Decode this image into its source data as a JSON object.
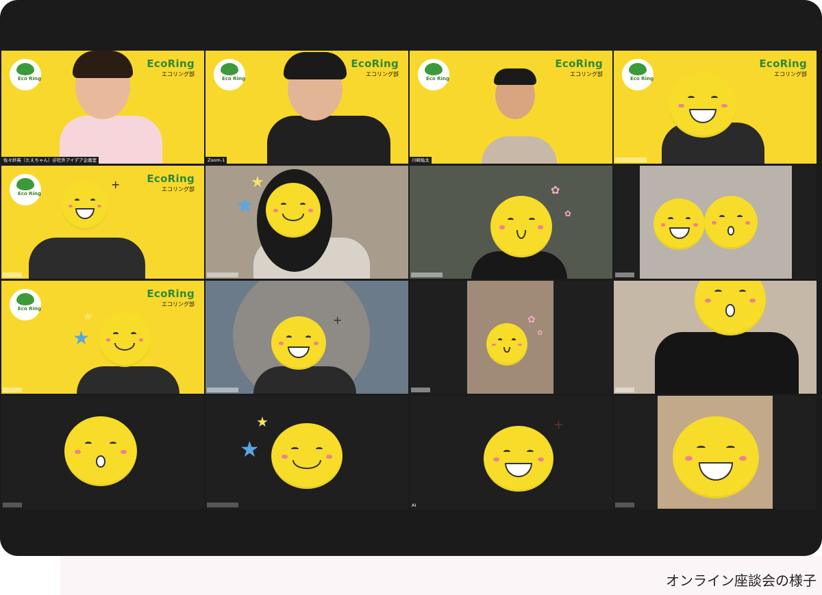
{
  "caption": "オンライン座談会の様子",
  "brand": {
    "title": "EcoRing",
    "subtitle": "エコリング部",
    "logo_text": "Eco Ring"
  },
  "participants": [
    {
      "name": "佐々紗英（たえちゃん）＠社外アイデア企画室"
    },
    {
      "name": "Zoom-1"
    },
    {
      "name": "川崎佑太"
    },
    {
      "name": ""
    },
    {
      "name": ""
    },
    {
      "name": ""
    },
    {
      "name": ""
    },
    {
      "name": ""
    },
    {
      "name": ""
    },
    {
      "name": ""
    },
    {
      "name": ""
    },
    {
      "name": ""
    },
    {
      "name": ""
    },
    {
      "name": ""
    },
    {
      "name": "AI"
    },
    {
      "name": ""
    }
  ],
  "colors": {
    "brand_yellow": "#f9d82d",
    "brand_green": "#2e8a35",
    "window_bg": "#1b1b1b"
  }
}
